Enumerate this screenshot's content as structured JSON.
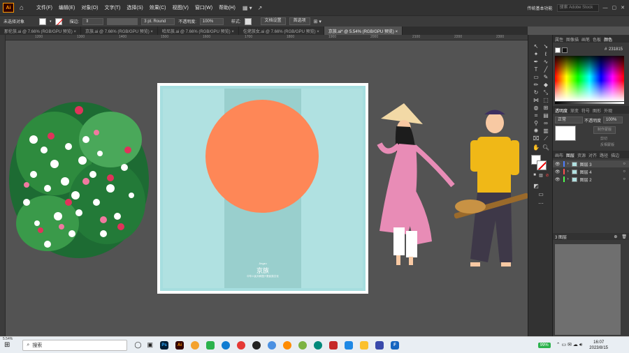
{
  "app": {
    "logo": "Ai",
    "menu": [
      "文件(F)",
      "编辑(E)",
      "对象(O)",
      "文字(T)",
      "选择(S)",
      "效果(C)",
      "视图(V)",
      "窗口(W)",
      "帮助(H)"
    ],
    "workspace": "传统基本功能",
    "search_placeholder": "搜索 Adobe Stock"
  },
  "options_bar": {
    "selection": "未选择对象",
    "stroke_label": "描边:",
    "stroke_profile": "3 pt. Round",
    "opacity_label": "不透明度:",
    "opacity_value": "100%",
    "style_label": "样式:",
    "doc_setup": "文档设置",
    "preferences": "首选项"
  },
  "tabs": [
    {
      "label": "那伦族.ai @ 7.66% (RGB/GPU 预览)",
      "active": false
    },
    {
      "label": "京族.ai @ 7.66% (RGB/GPU 预览)",
      "active": false
    },
    {
      "label": "哈尼族.ai @ 7.66% (RGB/GPU 预览)",
      "active": false
    },
    {
      "label": "仡佬族女.ai @ 7.66% (RGB/GPU 预览)",
      "active": false
    },
    {
      "label": "京族.ai* @ 5.54% (RGB/GPU 预览)",
      "active": true
    }
  ],
  "ruler": {
    "marks": [
      "1200",
      "1300",
      "1400",
      "1500",
      "1600",
      "1700",
      "1800",
      "1900",
      "2000",
      "2100",
      "2200",
      "2300"
    ]
  },
  "artboard": {
    "small_text": "Jingzu",
    "title": "京族",
    "subtitle": "中华人民共和国少数民族文化"
  },
  "panels": {
    "top_tabs": [
      "属性",
      "图像描",
      "画笔",
      "色板",
      "颜色"
    ],
    "hex": "231815",
    "transparency_tabs": [
      "透明度",
      "渐变",
      "符号",
      "图形",
      "外观"
    ],
    "blend_mode": "正常",
    "opacity_label": "不透明度",
    "opacity_value": "100%",
    "make_mask": "制作蒙版",
    "clip": "剪切",
    "invert_mask": "反相蒙版",
    "layer_tabs": [
      "画布",
      "图层",
      "资源",
      "对齐",
      "路径",
      "描边"
    ],
    "layers": [
      {
        "name": "图层 3",
        "color": "#4f7eff",
        "selected": true
      },
      {
        "name": "图层 4",
        "color": "#ff4f4f",
        "selected": false
      },
      {
        "name": "图层 2",
        "color": "#4fff4f",
        "selected": false
      }
    ],
    "layer_count": "3 图层"
  },
  "status": {
    "zoom": "5.54%"
  },
  "taskbar": {
    "search_label": "搜索",
    "battery": "99%",
    "time": "16:07",
    "date": "2023/8/15",
    "apps": [
      {
        "label": "Ps",
        "color": "#001e36"
      },
      {
        "label": "Ai",
        "color": "#330000"
      },
      {
        "label": "",
        "color": "#f4a22d"
      },
      {
        "label": "",
        "color": "#2bb24c"
      },
      {
        "label": "",
        "color": "#0f7cd2"
      },
      {
        "label": "",
        "color": "#e53935"
      },
      {
        "label": "",
        "color": "#222222"
      },
      {
        "label": "",
        "color": "#4a90e2"
      },
      {
        "label": "",
        "color": "#ff8c00"
      },
      {
        "label": "",
        "color": "#7cb342"
      },
      {
        "label": "",
        "color": "#00897b"
      },
      {
        "label": "",
        "color": "#c62828"
      },
      {
        "label": "",
        "color": "#1e88e5"
      },
      {
        "label": "",
        "color": "#fbc02d"
      },
      {
        "label": "",
        "color": "#3949ab"
      },
      {
        "label": "F",
        "color": "#1565c0"
      }
    ]
  }
}
